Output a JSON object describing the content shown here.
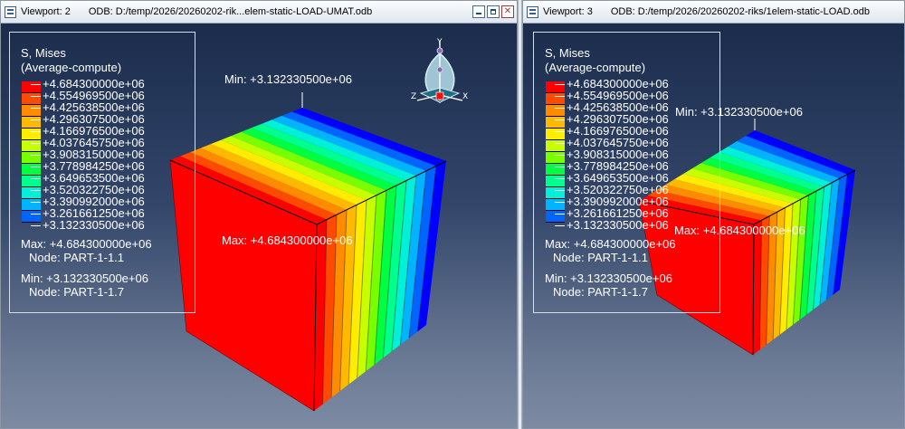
{
  "viewports": [
    {
      "viewport_label": "Viewport: 2",
      "odb_label": "ODB: D:/temp/2026/20260202-rik...elem-static-LOAD-UMAT.odb",
      "legend": {
        "title": "S, Mises",
        "subtitle": "(Average-compute)",
        "values": [
          "+4.684300000e+06",
          "+4.554969500e+06",
          "+4.425638500e+06",
          "+4.296307500e+06",
          "+4.166976500e+06",
          "+4.037645750e+06",
          "+3.908315000e+06",
          "+3.778984250e+06",
          "+3.649653500e+06",
          "+3.520322750e+06",
          "+3.390992000e+06",
          "+3.261661250e+06",
          "+3.132330500e+06"
        ],
        "max_label": "Max: +4.684300000e+06",
        "max_node": "Node: PART-1-1.1",
        "min_label": "Min: +3.132330500e+06",
        "min_node": "Node: PART-1-1.7"
      },
      "annotations": {
        "min": "Min: +3.132330500e+06",
        "max": "Max: +4.684300000e+06"
      },
      "triad": {
        "y": "Y",
        "z": "Z",
        "x": "X"
      }
    },
    {
      "viewport_label": "Viewport: 3",
      "odb_label": "ODB: D:/temp/2026/20260202-riks/1elem-static-LOAD.odb",
      "legend": {
        "title": "S, Mises",
        "subtitle": "(Average-compute)",
        "values": [
          "+4.684300000e+06",
          "+4.554969500e+06",
          "+4.425638500e+06",
          "+4.296307500e+06",
          "+4.166976500e+06",
          "+4.037645750e+06",
          "+3.908315000e+06",
          "+3.778984250e+06",
          "+3.649653500e+06",
          "+3.520322750e+06",
          "+3.390992000e+06",
          "+3.261661250e+06",
          "+3.132330500e+06"
        ],
        "max_label": "Max: +4.684300000e+06",
        "max_node": "Node: PART-1-1.1",
        "min_label": "Min: +3.132330500e+06",
        "min_node": "Node: PART-1-1.7"
      },
      "annotations": {
        "min": "Min: +3.132330500e+06",
        "max": "Max: +4.684300000e+06"
      }
    }
  ],
  "contour_colors": [
    "#ff0000",
    "#ff4a00",
    "#ff8c00",
    "#ffb900",
    "#ffec00",
    "#c8ff00",
    "#78ff00",
    "#00ff40",
    "#00ff8c",
    "#00f0d8",
    "#00b4ff",
    "#0064ff",
    "#0000ff"
  ]
}
